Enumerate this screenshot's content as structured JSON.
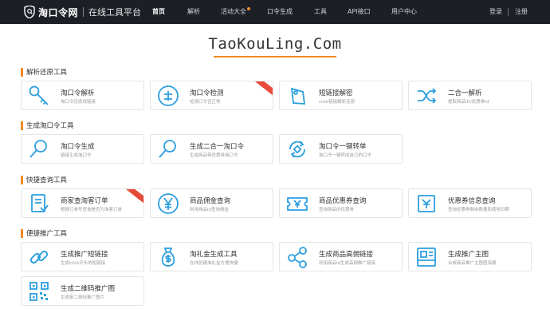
{
  "colors": {
    "topbar": "#1c1f26",
    "accent": "#f08a24",
    "icon": "#2d9fe0",
    "ribbon": "#e84a3a"
  },
  "header": {
    "brand_name": "淘口令网",
    "brand_tagline": "在线工具平台",
    "nav": [
      "首页",
      "解析",
      "活动大全",
      "口令生成",
      "工具",
      "API接口",
      "用户中心"
    ],
    "nav_active": "首页",
    "login": "登录",
    "register": "注册"
  },
  "site_title": "TaoKouLing.Com",
  "sections": [
    {
      "title": "解析还原工具",
      "cards": [
        {
          "title": "淘口令解析",
          "desc": "淘口令还原成链接",
          "icon": "key-icon"
        },
        {
          "title": "淘口令检测",
          "desc": "检测口令否正常",
          "icon": "verify-icon",
          "badge": "hot"
        },
        {
          "title": "短链接解密",
          "desc": "click链接解析还原",
          "icon": "tag-icon"
        },
        {
          "title": "二合一解析",
          "desc": "提取商品ID/优惠券id",
          "icon": "shuffle-icon"
        }
      ]
    },
    {
      "title": "生成淘口令工具",
      "cards": [
        {
          "title": "淘口令生成",
          "desc": "链接生成淘口令",
          "icon": "magnifier-icon"
        },
        {
          "title": "生成二合一淘口令",
          "desc": "生成商品带优惠券淘口令",
          "icon": "magnifier-icon"
        },
        {
          "title": "淘口令一键转单",
          "desc": "淘口令一键转成自己的口令",
          "icon": "refresh-icon"
        }
      ]
    },
    {
      "title": "快捷查询工具",
      "cards": [
        {
          "title": "商家查淘客订单",
          "desc": "根据订单号查询是否为淘客订单",
          "icon": "document-icon",
          "badge": "hot"
        },
        {
          "title": "商品佣金查询",
          "desc": "利用商品id查询佣金",
          "icon": "yen-coin-icon"
        },
        {
          "title": "商品优惠券查询",
          "desc": "查询商品的优惠券",
          "icon": "ticket-icon"
        },
        {
          "title": "优惠券信息查询",
          "desc": "查询优惠券剩余数量和使用日期",
          "icon": "coupon-icon"
        }
      ]
    },
    {
      "title": "便捷推广工具",
      "cards": [
        {
          "title": "生成推广短链接",
          "desc": "生成click开头的短链接",
          "icon": "link-icon"
        },
        {
          "title": "淘礼金生成工具",
          "desc": "在线创建淘礼金方便快捷",
          "icon": "money-bag-icon"
        },
        {
          "title": "生成商品高佣链接",
          "desc": "利用商品id生成高佣推广链接",
          "icon": "share-icon"
        },
        {
          "title": "生成推广主图",
          "desc": "合成商品推广主图图海报",
          "icon": "image-icon"
        },
        {
          "title": "生成二维码推广图",
          "desc": "生成带二维码推广图片",
          "icon": "qrcode-icon"
        }
      ]
    }
  ]
}
